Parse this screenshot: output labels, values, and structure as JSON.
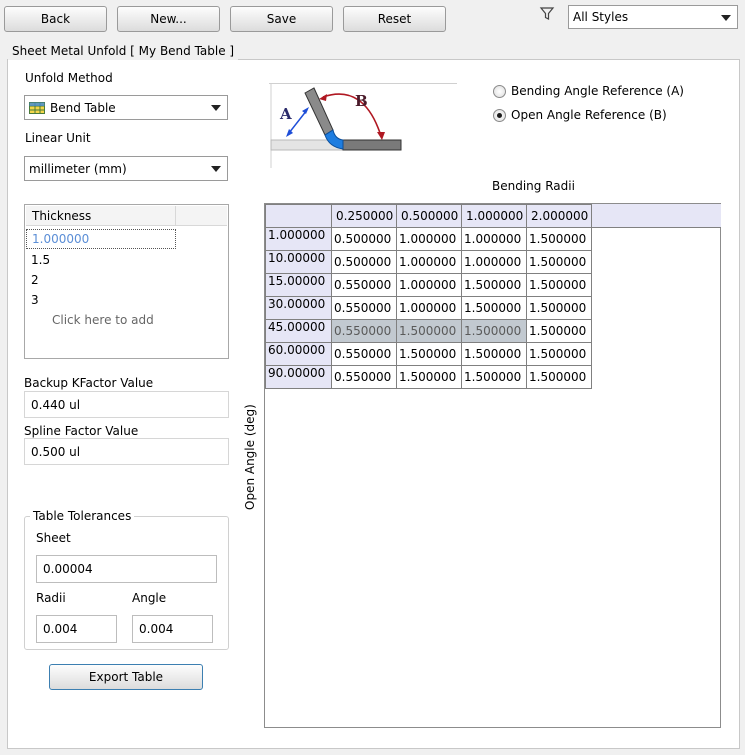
{
  "toolbar": {
    "back": "Back",
    "new": "New...",
    "save": "Save",
    "reset": "Reset",
    "style_filter": "All Styles"
  },
  "tab": {
    "title": "Sheet Metal Unfold [ My Bend Table ]"
  },
  "unfold_method": {
    "label": "Unfold Method",
    "value": "Bend Table"
  },
  "linear_unit": {
    "label": "Linear Unit",
    "value": "millimeter (mm)"
  },
  "thickness": {
    "header": "Thickness",
    "items": [
      "1.000000",
      "1.5",
      "2",
      "3"
    ],
    "add_hint": "Click here to add"
  },
  "backup_kfactor": {
    "label": "Backup KFactor Value",
    "value": "0.440 ul"
  },
  "spline_factor": {
    "label": "Spline Factor Value",
    "value": "0.500 ul"
  },
  "tolerances": {
    "legend": "Table Tolerances",
    "sheet_label": "Sheet",
    "sheet_value": "0.00004",
    "radii_label": "Radii",
    "radii_value": "0.004",
    "angle_label": "Angle",
    "angle_value": "0.004"
  },
  "export_button": "Export Table",
  "diagram": {
    "label_a": "A",
    "label_b": "B"
  },
  "angle_reference": {
    "option_a": "Bending Angle Reference (A)",
    "option_b": "Open Angle Reference (B)",
    "selected": "B"
  },
  "table": {
    "bending_radii_label": "Bending Radii",
    "open_angle_label": "Open Angle (deg)",
    "columns": [
      "0.250000",
      "0.500000",
      "1.000000",
      "2.000000"
    ],
    "rows": [
      {
        "angle": "1.000000",
        "values": [
          "0.500000",
          "1.000000",
          "1.000000",
          "1.500000"
        ]
      },
      {
        "angle": "10.00000",
        "values": [
          "0.500000",
          "1.000000",
          "1.000000",
          "1.500000"
        ]
      },
      {
        "angle": "15.00000",
        "values": [
          "0.550000",
          "1.000000",
          "1.500000",
          "1.500000"
        ]
      },
      {
        "angle": "30.00000",
        "values": [
          "0.550000",
          "1.000000",
          "1.500000",
          "1.500000"
        ]
      },
      {
        "angle": "45.00000",
        "values": [
          "0.550000",
          "1.500000",
          "1.500000",
          "1.500000"
        ]
      },
      {
        "angle": "60.00000",
        "values": [
          "0.550000",
          "1.500000",
          "1.500000",
          "1.500000"
        ]
      },
      {
        "angle": "90.00000",
        "values": [
          "0.550000",
          "1.500000",
          "1.500000",
          "1.500000"
        ]
      }
    ]
  }
}
